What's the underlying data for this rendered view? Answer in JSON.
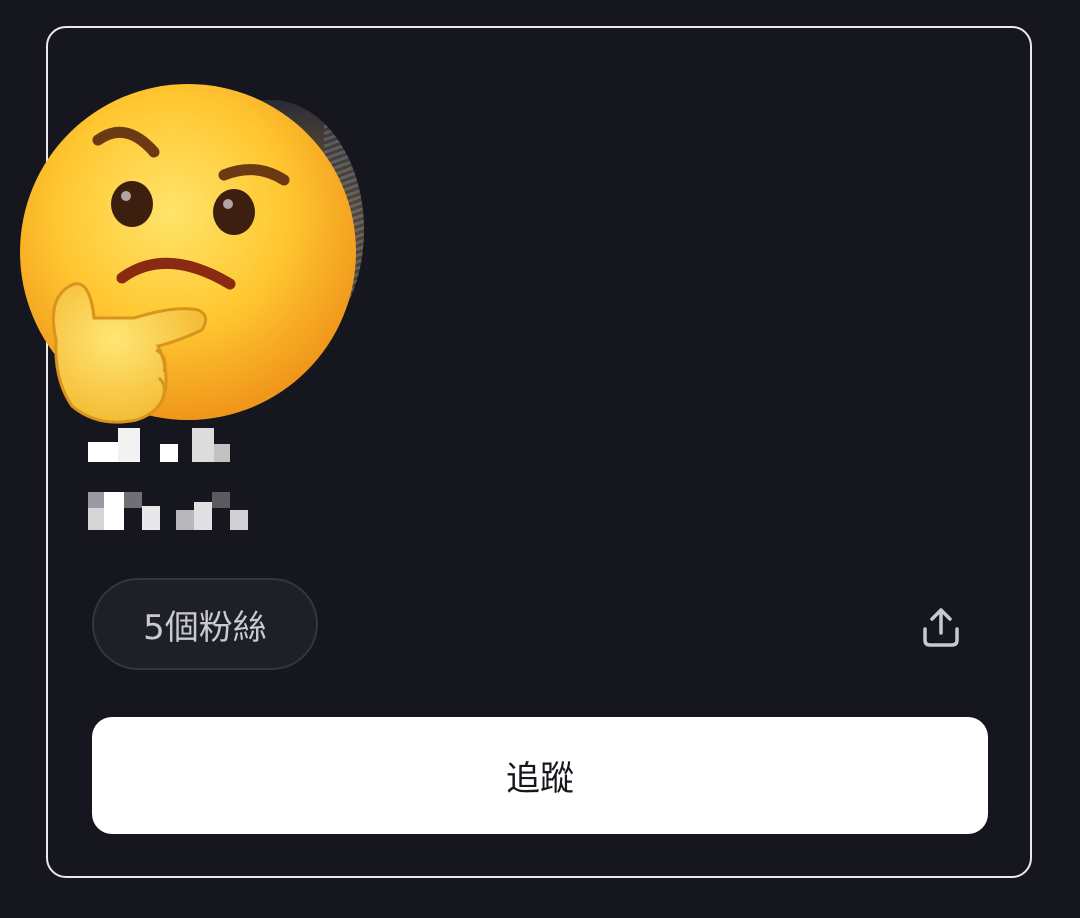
{
  "profile": {
    "followers_label": "5個粉絲",
    "follow_button_label": "追蹤",
    "share_icon": "share-upload-icon",
    "emoji_overlay": "thinking-face"
  },
  "colors": {
    "background": "#16161e",
    "card_border": "#e9e9ee",
    "pill_background": "#1e1f27",
    "pill_text": "#c9c9d0",
    "button_background": "#ffffff",
    "button_text": "#16161e"
  }
}
